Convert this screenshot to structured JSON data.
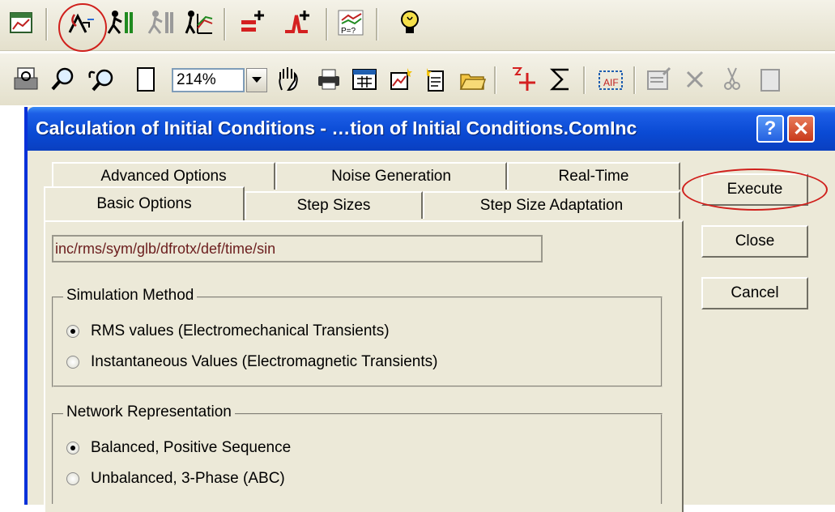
{
  "toolbar_top": {
    "icons": [
      "graph-window-icon",
      "initial-conditions-icon",
      "start-simulation-icon",
      "stop-simulation-icon",
      "plot-icon",
      "add-variable-icon",
      "add-event-icon",
      "probability-icon",
      "bulb-icon"
    ]
  },
  "toolbar_bottom": {
    "icons": [
      "print-preview-icon",
      "zoom-in-icon",
      "zoom-out-icon",
      "page-icon"
    ],
    "zoom_value": "214%",
    "icons_after": [
      "pan-hand-icon",
      "printer-icon",
      "calculator-icon",
      "new-graphic-icon",
      "new-document-icon",
      "open-folder-icon",
      "add-point-icon",
      "sum-icon",
      "select-area-icon",
      "edit-icon",
      "delete-icon",
      "cut-icon"
    ]
  },
  "dialog": {
    "title": "Calculation of Initial Conditions - …tion of Initial Conditions.ComInc",
    "help_label": "?",
    "close_label": "✕",
    "tabs_row1": [
      "Advanced Options",
      "Noise Generation",
      "Real-Time"
    ],
    "tabs_row2": [
      "Basic Options",
      "Step Sizes",
      "Step Size Adaptation"
    ],
    "command_path": "inc/rms/sym/glb/dfrotx/def/time/sin",
    "simulation_method": {
      "label": "Simulation Method",
      "options": [
        "RMS values (Electromechanical Transients)",
        "Instantaneous Values (Electromagnetic Transients)"
      ],
      "selected": 0
    },
    "network_representation": {
      "label": "Network Representation",
      "options": [
        "Balanced, Positive Sequence",
        "Unbalanced, 3-Phase (ABC)"
      ],
      "selected": 0
    },
    "buttons": {
      "execute": "Execute",
      "close": "Close",
      "cancel": "Cancel"
    }
  },
  "colors": {
    "highlight_circle": "#d0201c",
    "title_bar": "#0a4ad4",
    "path_text": "#6b1d1d"
  }
}
